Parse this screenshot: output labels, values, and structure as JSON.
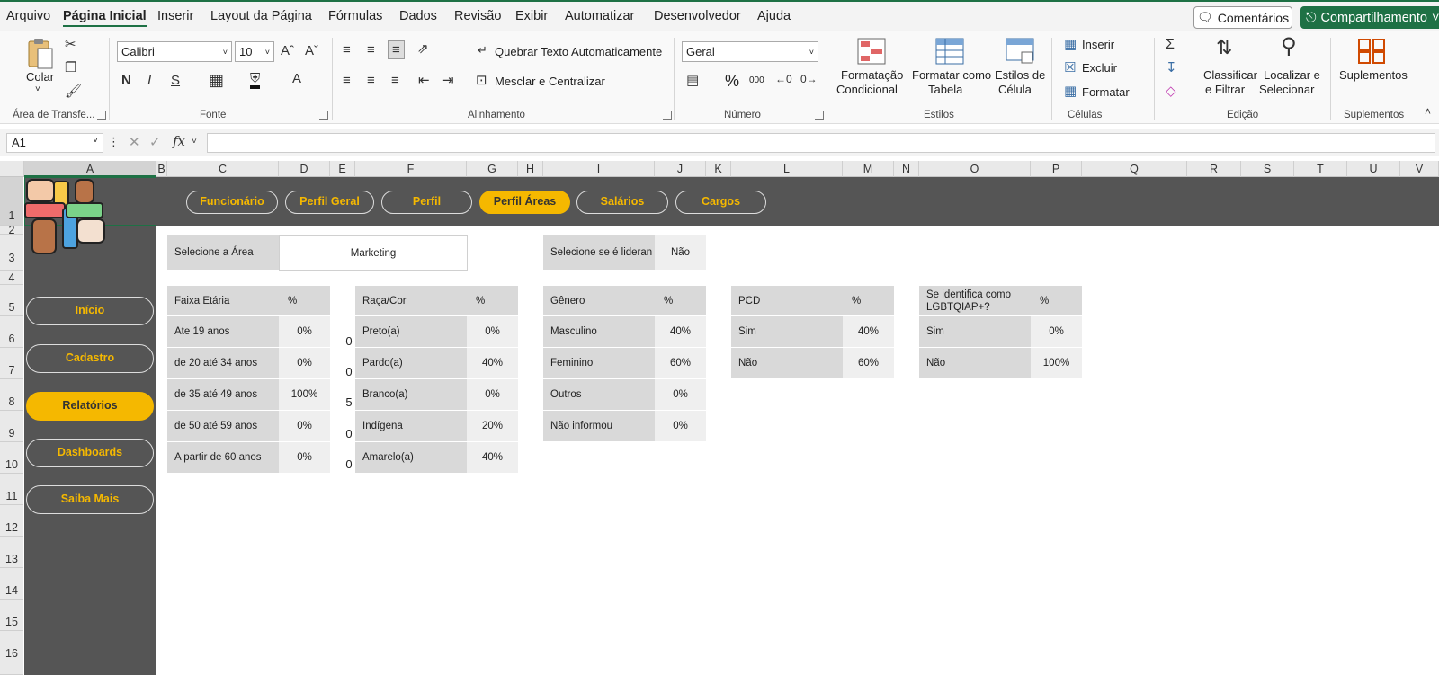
{
  "menu": {
    "items": [
      "Arquivo",
      "Página Inicial",
      "Inserir",
      "Layout da Página",
      "Fórmulas",
      "Dados",
      "Revisão",
      "Exibir",
      "Automatizar",
      "Desenvolvedor",
      "Ajuda"
    ],
    "comments": "Comentários",
    "share": "Compartilhamento"
  },
  "ribbon": {
    "paste": "Colar",
    "clipboard_group": "Área de Transfe...",
    "font_name": "Calibri",
    "font_size": "10",
    "font_group": "Fonte",
    "wrap_text": "Quebrar Texto Automaticamente",
    "merge_center": "Mesclar e Centralizar",
    "alignment_group": "Alinhamento",
    "number_format": "Geral",
    "number_group": "Número",
    "percent": "%",
    "thousands": "000",
    "cond_format_1": "Formatação",
    "cond_format_2": "Condicional",
    "format_table_1": "Formatar como",
    "format_table_2": "Tabela",
    "cell_styles_1": "Estilos de",
    "cell_styles_2": "Célula",
    "styles_group": "Estilos",
    "insert": "Inserir",
    "delete": "Excluir",
    "format": "Formatar",
    "cells_group": "Células",
    "sort_1": "Classificar",
    "sort_2": "e Filtrar",
    "find_1": "Localizar e",
    "find_2": "Selecionar",
    "editing_group": "Edição",
    "addins": "Suplementos",
    "addins_group": "Suplementos"
  },
  "formula_bar": {
    "name_box": "A1",
    "fx": "fx",
    "formula": ""
  },
  "columns": [
    "A",
    "B",
    "C",
    "D",
    "E",
    "F",
    "G",
    "H",
    "I",
    "J",
    "K",
    "L",
    "M",
    "N",
    "O",
    "P",
    "Q",
    "R",
    "S",
    "T",
    "U",
    "V"
  ],
  "rows": [
    "1",
    "2",
    "3",
    "4",
    "5",
    "6",
    "7",
    "8",
    "9",
    "10",
    "11",
    "12",
    "13",
    "14",
    "15",
    "16"
  ],
  "nav_top": [
    "Funcionário",
    "Perfil Geral",
    "Perfil",
    "Perfil Áreas",
    "Salários",
    "Cargos"
  ],
  "nav_side": [
    "Início",
    "Cadastro",
    "Relatórios",
    "Dashboards",
    "Saiba Mais"
  ],
  "filters": {
    "area_label": "Selecione a Área",
    "area_value": "Marketing",
    "leader_label": "Selecione se é lideran",
    "leader_value": "Não"
  },
  "tables": {
    "faixa": {
      "header": "Faixa Etária",
      "pct": "%",
      "rows": [
        [
          "Ate 19 anos",
          "0%"
        ],
        [
          "de 20 até 34 anos",
          "0%"
        ],
        [
          "de 35 até 49 anos",
          "100%"
        ],
        [
          "de 50 até 59 anos",
          "0%"
        ],
        [
          "A partir de 60 anos",
          "0%"
        ]
      ]
    },
    "col_e_values": [
      "0",
      "0",
      "5",
      "0",
      "0"
    ],
    "raca": {
      "header": "Raça/Cor",
      "pct": "%",
      "rows": [
        [
          "Preto(a)",
          "0%"
        ],
        [
          "Pardo(a)",
          "40%"
        ],
        [
          "Branco(a)",
          "0%"
        ],
        [
          "Indígena",
          "20%"
        ],
        [
          "Amarelo(a)",
          "40%"
        ]
      ]
    },
    "genero": {
      "header": "Gênero",
      "pct": "%",
      "rows": [
        [
          "Masculino",
          "40%"
        ],
        [
          "Feminino",
          "60%"
        ],
        [
          "Outros",
          "0%"
        ],
        [
          "Não informou",
          "0%"
        ]
      ]
    },
    "pcd": {
      "header": "PCD",
      "pct": "%",
      "rows": [
        [
          "Sim",
          "40%"
        ],
        [
          "Não",
          "60%"
        ]
      ]
    },
    "lgbt": {
      "header": "Se identifica como LGBTQIAP+?",
      "pct": "%",
      "rows": [
        [
          "Sim",
          "0%"
        ],
        [
          "Não",
          "100%"
        ]
      ]
    }
  }
}
